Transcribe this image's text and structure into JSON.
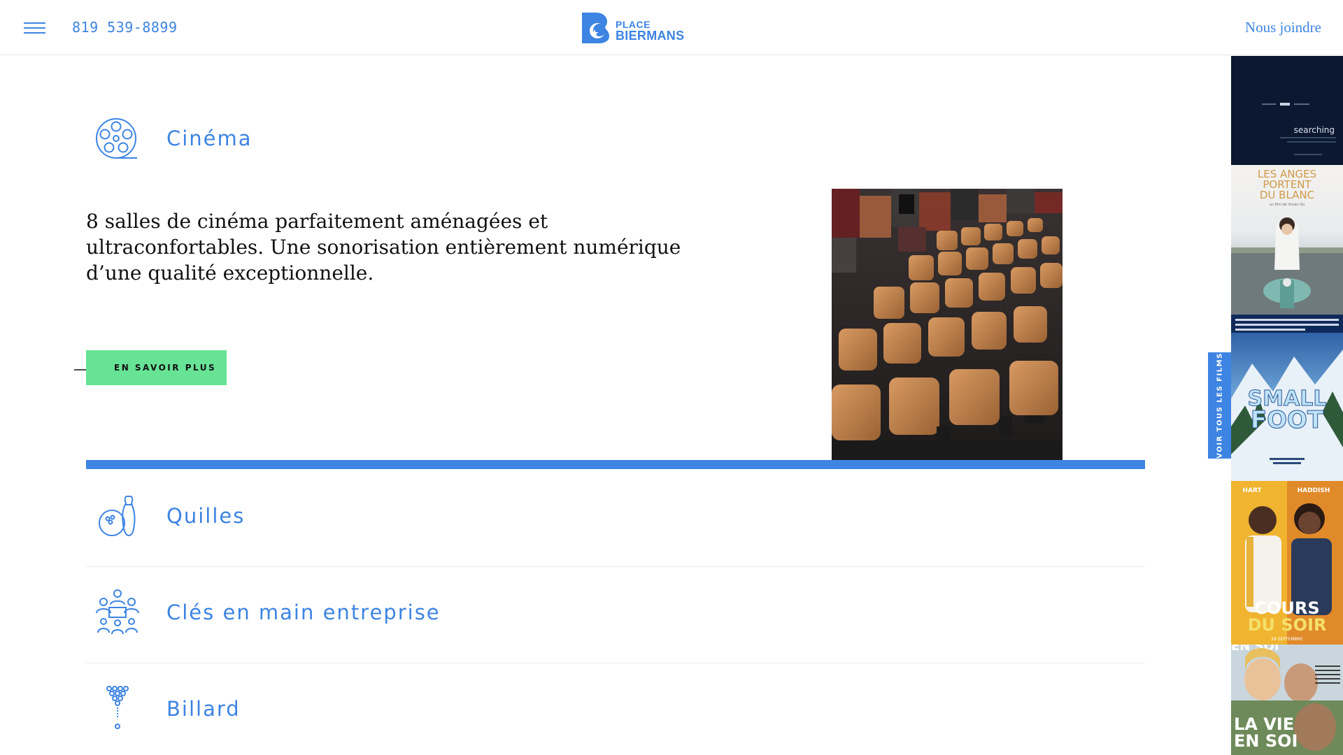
{
  "header": {
    "phone": "819 539-8899",
    "logo_place": "PLACE",
    "logo_biermans": "BIERMANS",
    "contact_label": "Nous joindre"
  },
  "cinema": {
    "title": "Cinéma",
    "description": "8 salles de cinéma parfaitement aménagées et ultraconfortables. Une sonorisation entièrement numérique d’une qualité exceptionnelle.",
    "cta_label": "EN SAVOIR PLUS"
  },
  "sections": [
    {
      "title": "Quilles",
      "icon": "bowling-icon"
    },
    {
      "title": "Clés en main entreprise",
      "icon": "group-meeting-icon"
    },
    {
      "title": "Billard",
      "icon": "billiard-icon"
    }
  ],
  "sidebar": {
    "see_all_label": "VOIR TOUS LES FILMS",
    "posters": [
      {
        "title": "searching"
      },
      {
        "title": "LES ANGES PORTENT DU BLANC",
        "credit": "un film de Vivian Qu"
      },
      {
        "title": "SMALLFOOT"
      },
      {
        "title": "COURS DU SOIR",
        "top_left": "HART",
        "top_right": "HADDISH",
        "date": "28 SEPTEMBRE"
      },
      {
        "title": "LA VIE EN SOI"
      }
    ]
  },
  "colors": {
    "brand_blue": "#3d84e3",
    "cta_green": "#67e396"
  }
}
